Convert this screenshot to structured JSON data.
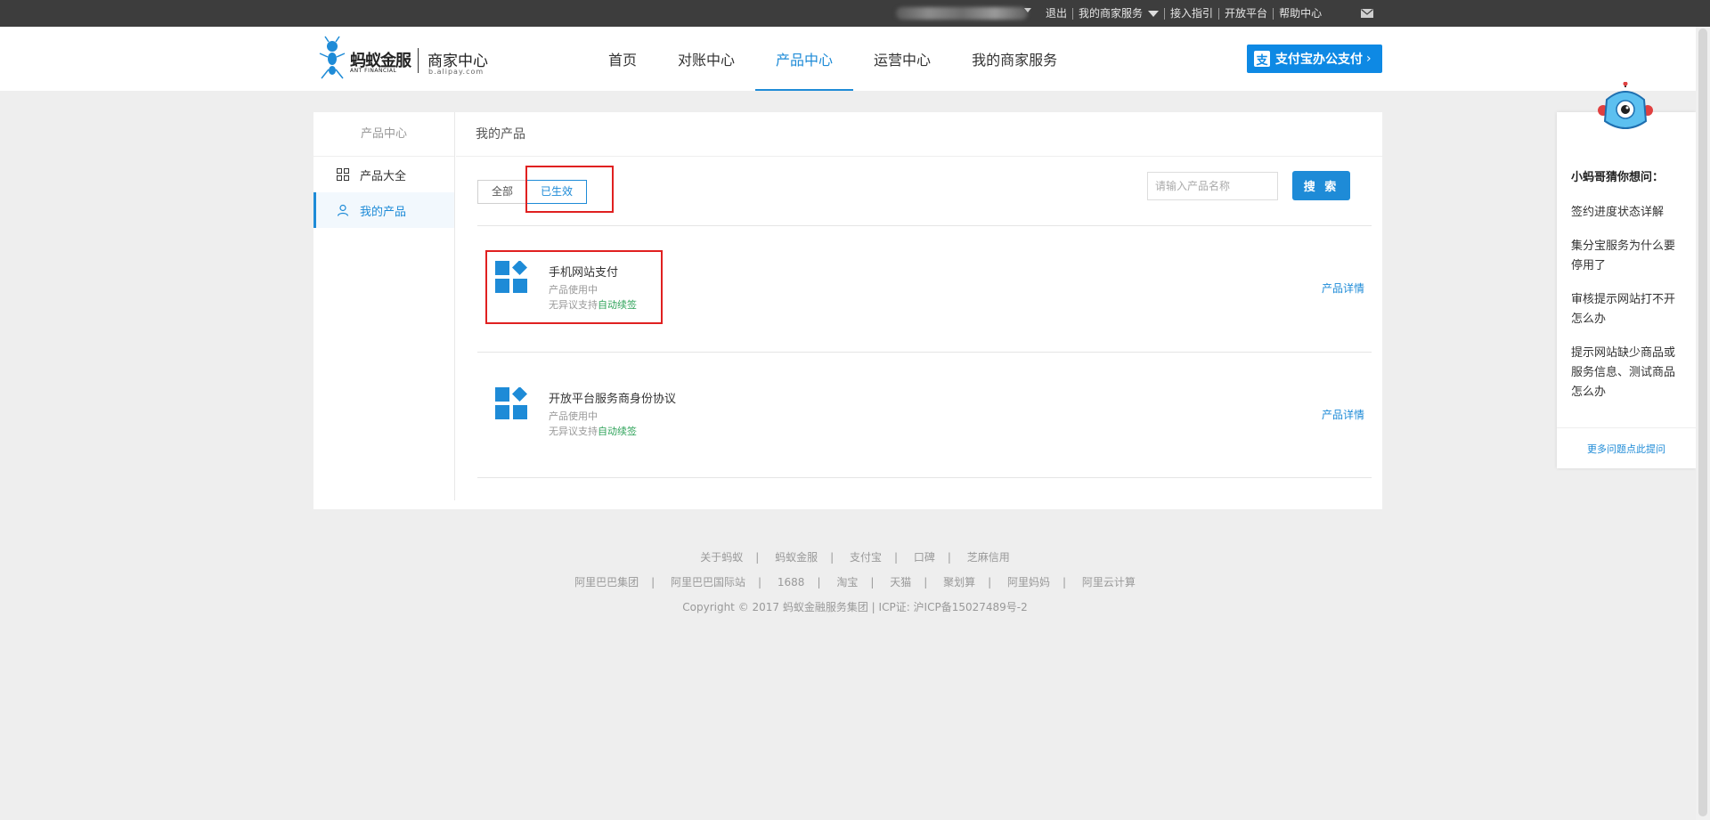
{
  "topbar": {
    "links": [
      "退出",
      "我的商家服务",
      "接入指引",
      "开放平台",
      "帮助中心"
    ]
  },
  "logo": {
    "brand": "蚂蚁金服",
    "brand_en": "ANT FINANCIAL",
    "center": "商家中心",
    "center_en": "b.alipay.com"
  },
  "nav": {
    "items": [
      "首页",
      "对账中心",
      "产品中心",
      "运营中心",
      "我的商家服务"
    ],
    "active": "产品中心"
  },
  "pay_button": {
    "icon": "支",
    "label": "支付宝办公支付"
  },
  "sidebar": {
    "title": "产品中心",
    "items": [
      {
        "label": "产品大全",
        "icon": "grid-icon"
      },
      {
        "label": "我的产品",
        "icon": "user-icon"
      }
    ]
  },
  "content": {
    "title": "我的产品",
    "tabs": [
      "全部",
      "已生效"
    ],
    "active_tab": "已生效",
    "search": {
      "placeholder": "请输入产品名称",
      "button": "搜 索"
    },
    "products": [
      {
        "name": "手机网站支付",
        "status": "产品使用中",
        "renew_prefix": "无异议支持",
        "renew_link": "自动续签",
        "detail": "产品详情"
      },
      {
        "name": "开放平台服务商身份协议",
        "status": "产品使用中",
        "renew_prefix": "无异议支持",
        "renew_link": "自动续签",
        "detail": "产品详情"
      }
    ]
  },
  "footer": {
    "row1": [
      "关于蚂蚁",
      "蚂蚁金服",
      "支付宝",
      "口碑",
      "芝麻信用"
    ],
    "row2": [
      "阿里巴巴集团",
      "阿里巴巴国际站",
      "1688",
      "淘宝",
      "天猫",
      "聚划算",
      "阿里妈妈",
      "阿里云计算"
    ],
    "copyright": "Copyright © 2017 蚂蚁金融服务集团 | ICP证: 沪ICP备15027489号-2"
  },
  "assistant": {
    "title": "小蚂哥猜你想问：",
    "questions": [
      "签约进度状态详解",
      "集分宝服务为什么要停用了",
      "审核提示网站打不开怎么办",
      "提示网站缺少商品或服务信息、测试商品怎么办"
    ],
    "more": "更多问题点此提问"
  },
  "colors": {
    "accent": "#1e8bd7",
    "topbar": "#3d3d3d",
    "green": "#2fa35a",
    "highlight": "#e02020"
  }
}
